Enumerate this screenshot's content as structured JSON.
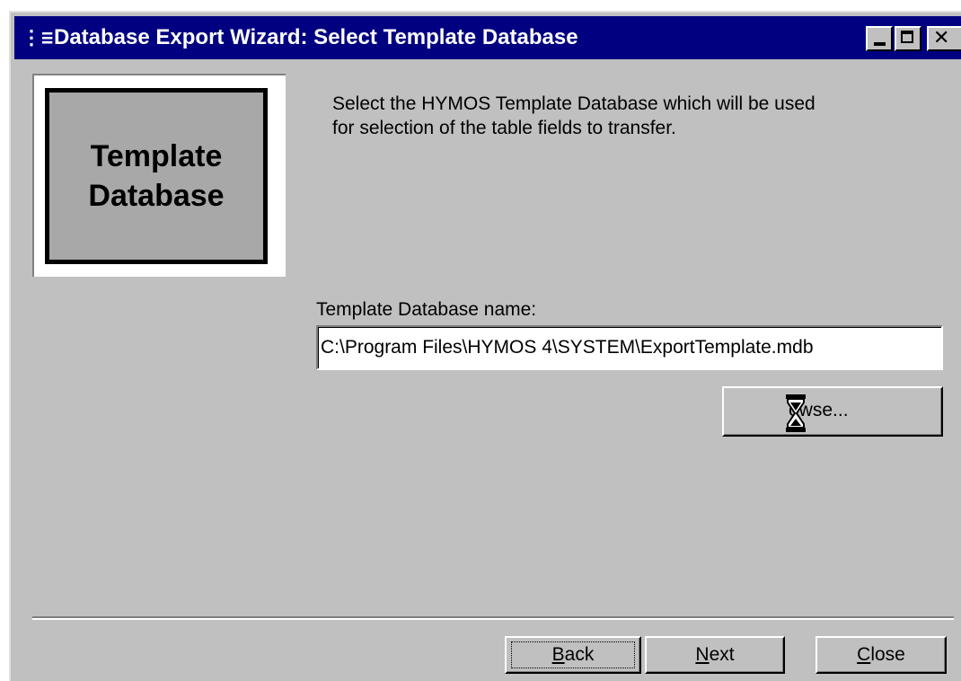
{
  "window": {
    "title": "Database Export Wizard: Select Template Database",
    "icon": "wizard-app-icon",
    "controls": {
      "minimize": "minimize-icon",
      "maximize": "maximize-icon",
      "close": "close-icon"
    }
  },
  "logo": {
    "line1": "Template",
    "line2": "Database"
  },
  "instructions": {
    "line1": "Select the HYMOS Template Database which will be used",
    "line2": "for selection of the table fields to transfer."
  },
  "template_field": {
    "label": "Template Database name:",
    "value": "C:\\Program Files\\HYMOS 4\\SYSTEM\\ExportTemplate.mdb"
  },
  "browse_button": {
    "label_visible": "owse...",
    "cursor": "hourglass-cursor-icon"
  },
  "nav": {
    "back": {
      "mnemonic": "B",
      "rest": "ack"
    },
    "next": {
      "mnemonic": "N",
      "rest": "ext"
    },
    "close": {
      "mnemonic": "C",
      "rest": "lose"
    }
  },
  "colors": {
    "titlebar": "#000080",
    "face": "#c0c0c0",
    "logo_fill": "#a8a8a8"
  }
}
